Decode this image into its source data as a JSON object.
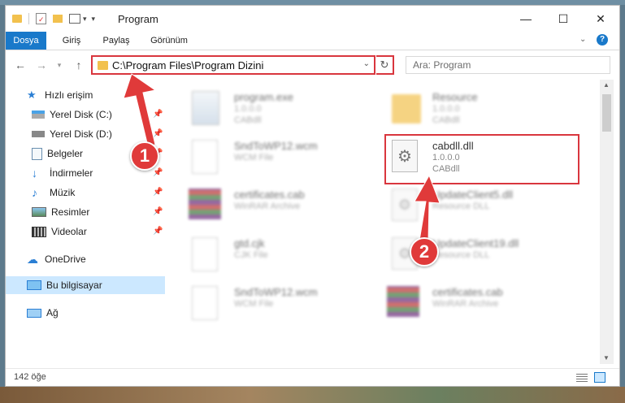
{
  "window": {
    "title": "Program"
  },
  "ribbon": {
    "tabs": [
      "Dosya",
      "Giriş",
      "Paylaş",
      "Görünüm"
    ]
  },
  "address": {
    "path": "C:\\Program Files\\Program Dizini"
  },
  "search": {
    "placeholder": "Ara: Program"
  },
  "nav": {
    "items": [
      {
        "label": "Hızlı erişim"
      },
      {
        "label": "Yerel Disk (C:)"
      },
      {
        "label": "Yerel Disk (D:)"
      },
      {
        "label": "Belgeler"
      },
      {
        "label": "İndirmeler"
      },
      {
        "label": "Müzik"
      },
      {
        "label": "Resimler"
      },
      {
        "label": "Videolar"
      },
      {
        "label": "OneDrive"
      },
      {
        "label": "Bu bilgisayar"
      },
      {
        "label": "Ağ"
      }
    ]
  },
  "files": [
    {
      "name": "program.exe",
      "line2": "1.0.0.0",
      "line3": "CABdll"
    },
    {
      "name": "Resource",
      "line2": "1.0.0.0",
      "line3": "CABdll"
    },
    {
      "name": "SndToWP12.wcm",
      "line2": "WCM File",
      "line3": ""
    },
    {
      "name": "cabdll.dll",
      "line2": "1.0.0.0",
      "line3": "CABdll"
    },
    {
      "name": "certificates.cab",
      "line2": "WinRAR Archive",
      "line3": ""
    },
    {
      "name": "UpdateClient5.dll",
      "line2": "Resource DLL",
      "line3": ""
    },
    {
      "name": "gtd.cjk",
      "line2": "CJK File",
      "line3": ""
    },
    {
      "name": "UpdateClient19.dll",
      "line2": "Resource DLL",
      "line3": ""
    },
    {
      "name": "SndToWP12.wcm",
      "line2": "WCM File",
      "line3": ""
    },
    {
      "name": "certificates.cab",
      "line2": "WinRAR Archive",
      "line3": ""
    }
  ],
  "status": {
    "item_count": "142 öğe"
  },
  "annotations": {
    "step1": "1",
    "step2": "2"
  },
  "colors": {
    "accent": "#1979ca",
    "highlight": "#d9363e",
    "selected_nav": "#cce8ff"
  }
}
